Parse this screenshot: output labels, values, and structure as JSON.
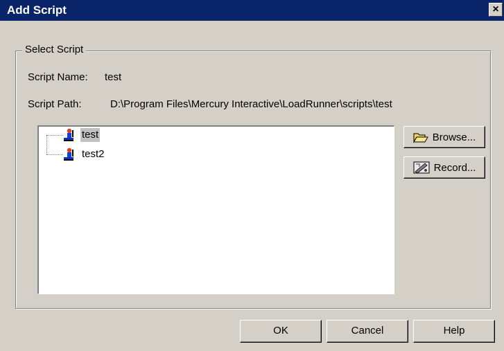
{
  "window": {
    "title": "Add Script",
    "close_glyph": "×"
  },
  "group": {
    "label": "Select Script"
  },
  "fields": {
    "name_label": "Script Name:",
    "name_value": "test",
    "path_label": "Script Path:",
    "path_value": "D:\\Program Files\\Mercury Interactive\\LoadRunner\\scripts\\test"
  },
  "tree": {
    "items": [
      {
        "label": "test",
        "selected": true,
        "icon": "script-user-icon"
      },
      {
        "label": "test2",
        "selected": false,
        "icon": "script-user-icon"
      }
    ]
  },
  "side_buttons": {
    "browse": {
      "label": "Browse...",
      "icon": "folder-open-icon"
    },
    "record": {
      "label": "Record...",
      "icon": "record-icon"
    }
  },
  "buttons": {
    "ok": "OK",
    "cancel": "Cancel",
    "help": "Help"
  },
  "colors": {
    "titlebar": "#0a246a",
    "face": "#d4d0c8",
    "selection": "#c0c0c0"
  }
}
